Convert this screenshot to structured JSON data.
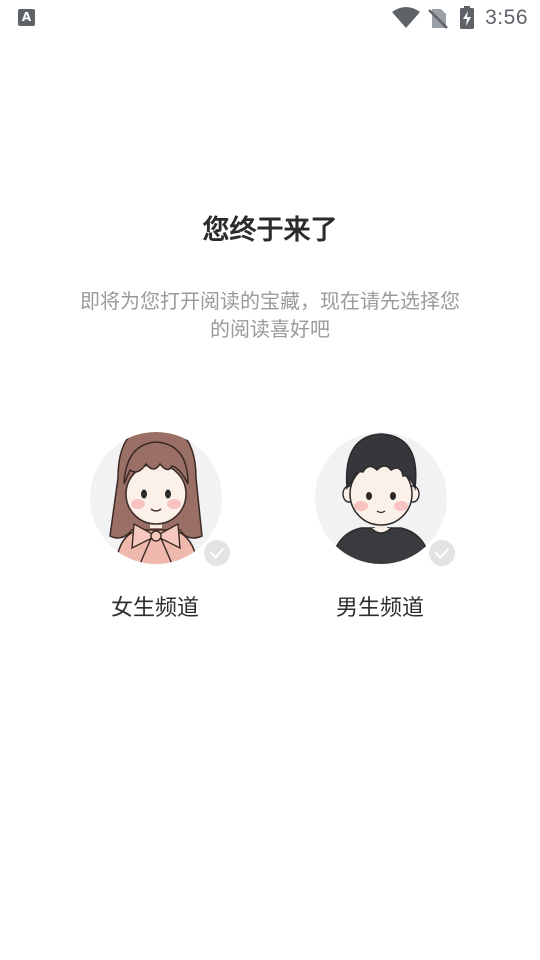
{
  "status_bar": {
    "app_indicator": "A",
    "time": "3:56",
    "icons": [
      "wifi-icon",
      "no-sim-icon",
      "battery-charging-icon"
    ]
  },
  "welcome": {
    "title": "您终于来了",
    "subtitle": "即将为您打开阅读的宝藏，现在请先选择您的阅读喜好吧"
  },
  "channels": [
    {
      "label": "女生频道",
      "avatar": "girl-avatar",
      "selected": false
    },
    {
      "label": "男生频道",
      "avatar": "boy-avatar",
      "selected": false
    }
  ],
  "colors": {
    "title": "#2b2b2b",
    "subtitle": "#9a9a9a",
    "avatar_bg": "#f2f1f4",
    "check_badge": "#e3e3e3",
    "status_icons": "#5f6368"
  }
}
